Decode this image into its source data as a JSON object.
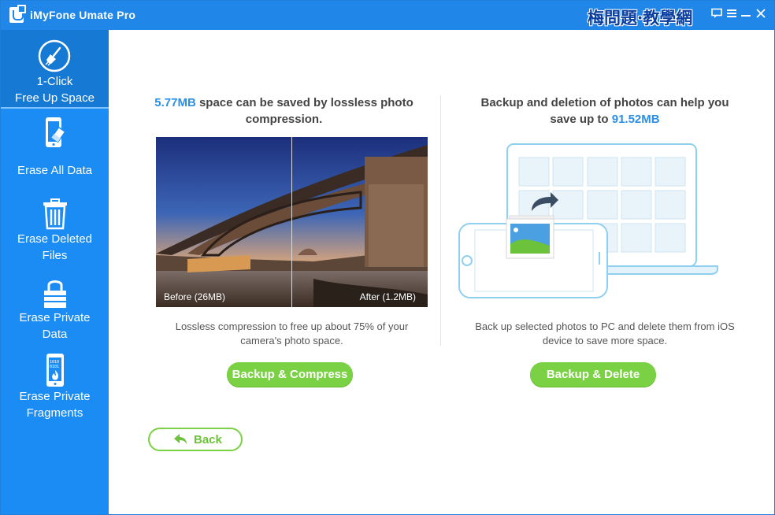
{
  "window": {
    "title": "iMyFone Umate Pro",
    "watermark": "梅問題·教學網"
  },
  "titlebar_controls": [
    "feedback-icon",
    "menu-icon",
    "minimize-icon",
    "close-icon"
  ],
  "sidebar": {
    "items": [
      {
        "line1": "1-Click",
        "line2": "Free Up Space",
        "icon": "broom-icon",
        "active": true
      },
      {
        "line1": "Erase All Data",
        "line2": "",
        "icon": "phone-eraser-icon",
        "active": false
      },
      {
        "line1": "Erase Deleted",
        "line2": "Files",
        "icon": "trash-icon",
        "active": false
      },
      {
        "line1": "Erase Private",
        "line2": "Data",
        "icon": "lock-icon",
        "active": false
      },
      {
        "line1": "Erase Private",
        "line2": "Fragments",
        "icon": "phone-fire-icon",
        "active": false
      }
    ]
  },
  "compress": {
    "amount": "5.77MB",
    "title_rest": " space can be saved by lossless photo",
    "title_line2": "compression.",
    "before_label": "Before (26MB)",
    "after_label": "After (1.2MB)",
    "desc_line1": "Lossless compression to free up about 75% of your",
    "desc_line2": "camera's photo space.",
    "button": "Backup & Compress"
  },
  "backup": {
    "title_line1": "Backup and deletion of photos can help you",
    "title_prefix": "save up to ",
    "amount": "91.52MB",
    "desc_line1": "Back up selected photos to PC and delete them from iOS",
    "desc_line2": "device to save more space.",
    "button": "Backup & Delete"
  },
  "back_button": "Back",
  "colors": {
    "titlebar": "#2086e8",
    "sidebar": "#1b8cf3",
    "accent_green": "#7ad143",
    "highlight_blue": "#2d8ee6"
  }
}
